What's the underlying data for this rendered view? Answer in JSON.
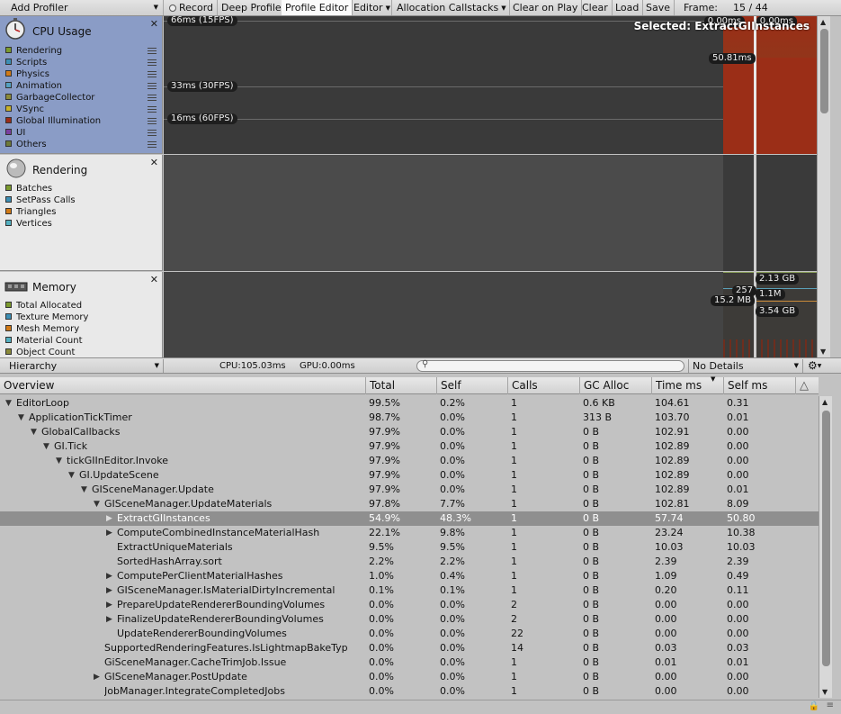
{
  "toolbar": {
    "add_profiler": "Add Profiler",
    "record": "Record",
    "deep_profile": "Deep Profile",
    "profile_editor": "Profile Editor",
    "editor": "Editor",
    "allocation_callstacks": "Allocation Callstacks",
    "clear_on_play": "Clear on Play",
    "clear": "Clear",
    "load": "Load",
    "save": "Save",
    "frame_label": "Frame:",
    "frame_value": "15 / 44"
  },
  "cpu_panel": {
    "title": "CPU Usage",
    "items": [
      {
        "label": "Rendering",
        "color": "#7b9a2e"
      },
      {
        "label": "Scripts",
        "color": "#3d8fb5"
      },
      {
        "label": "Physics",
        "color": "#d17a17"
      },
      {
        "label": "Animation",
        "color": "#54a0c0"
      },
      {
        "label": "GarbageCollector",
        "color": "#8a8a3a"
      },
      {
        "label": "VSync",
        "color": "#c9b22a"
      },
      {
        "label": "Global Illumination",
        "color": "#9b2d1a"
      },
      {
        "label": "UI",
        "color": "#7a3fa0"
      },
      {
        "label": "Others",
        "color": "#6e7a3a"
      }
    ],
    "fps_labels": [
      "66ms (15FPS)",
      "33ms (30FPS)",
      "16ms (60FPS)"
    ],
    "selected_label": "Selected: ExtractGIInstances",
    "top_values": [
      "0.00ms",
      "0.00ms"
    ],
    "selected_value": "50.81ms"
  },
  "rendering_panel": {
    "title": "Rendering",
    "items": [
      {
        "label": "Batches",
        "color": "#7b9a2e"
      },
      {
        "label": "SetPass Calls",
        "color": "#3d8fb5"
      },
      {
        "label": "Triangles",
        "color": "#d17a17"
      },
      {
        "label": "Vertices",
        "color": "#54b0c0"
      }
    ]
  },
  "memory_panel": {
    "title": "Memory",
    "items": [
      {
        "label": "Total Allocated",
        "color": "#7b9a2e"
      },
      {
        "label": "Texture Memory",
        "color": "#3d8fb5"
      },
      {
        "label": "Mesh Memory",
        "color": "#d17a17"
      },
      {
        "label": "Material Count",
        "color": "#54b0c0"
      },
      {
        "label": "Object Count",
        "color": "#8a8a3a"
      }
    ],
    "values": {
      "total": "2.13 GB",
      "count": "257",
      "objects": "1.1M",
      "mesh": "15.2 MB",
      "reserved": "3.54 GB"
    }
  },
  "details_bar": {
    "view_mode": "Hierarchy",
    "cpu": "CPU:105.03ms",
    "gpu": "GPU:0.00ms",
    "search_placeholder": "",
    "details_mode": "No Details"
  },
  "table": {
    "headers": [
      "Overview",
      "Total",
      "Self",
      "Calls",
      "GC Alloc",
      "Time ms",
      "Self ms"
    ],
    "rows": [
      {
        "name": "EditorLoop",
        "depth": 0,
        "expander": "open",
        "total": "99.5%",
        "self": "0.2%",
        "calls": "1",
        "gc": "0.6 KB",
        "time": "104.61",
        "selfms": "0.31"
      },
      {
        "name": "ApplicationTickTimer",
        "depth": 1,
        "expander": "open",
        "total": "98.7%",
        "self": "0.0%",
        "calls": "1",
        "gc": "313 B",
        "time": "103.70",
        "selfms": "0.01"
      },
      {
        "name": "GlobalCallbacks",
        "depth": 2,
        "expander": "open",
        "total": "97.9%",
        "self": "0.0%",
        "calls": "1",
        "gc": "0 B",
        "time": "102.91",
        "selfms": "0.00"
      },
      {
        "name": "GI.Tick",
        "depth": 3,
        "expander": "open",
        "total": "97.9%",
        "self": "0.0%",
        "calls": "1",
        "gc": "0 B",
        "time": "102.89",
        "selfms": "0.00"
      },
      {
        "name": "tickGIInEditor.Invoke",
        "depth": 4,
        "expander": "open",
        "total": "97.9%",
        "self": "0.0%",
        "calls": "1",
        "gc": "0 B",
        "time": "102.89",
        "selfms": "0.00"
      },
      {
        "name": "GI.UpdateScene",
        "depth": 5,
        "expander": "open",
        "total": "97.9%",
        "self": "0.0%",
        "calls": "1",
        "gc": "0 B",
        "time": "102.89",
        "selfms": "0.00"
      },
      {
        "name": "GISceneManager.Update",
        "depth": 6,
        "expander": "open",
        "total": "97.9%",
        "self": "0.0%",
        "calls": "1",
        "gc": "0 B",
        "time": "102.89",
        "selfms": "0.01"
      },
      {
        "name": "GISceneManager.UpdateMaterials",
        "depth": 7,
        "expander": "open",
        "total": "97.8%",
        "self": "7.7%",
        "calls": "1",
        "gc": "0 B",
        "time": "102.81",
        "selfms": "8.09"
      },
      {
        "name": "ExtractGIInstances",
        "depth": 8,
        "expander": "closed",
        "selected": true,
        "total": "54.9%",
        "self": "48.3%",
        "calls": "1",
        "gc": "0 B",
        "time": "57.74",
        "selfms": "50.80"
      },
      {
        "name": "ComputeCombinedInstanceMaterialHash",
        "depth": 8,
        "expander": "closed",
        "total": "22.1%",
        "self": "9.8%",
        "calls": "1",
        "gc": "0 B",
        "time": "23.24",
        "selfms": "10.38"
      },
      {
        "name": "ExtractUniqueMaterials",
        "depth": 8,
        "expander": "none",
        "total": "9.5%",
        "self": "9.5%",
        "calls": "1",
        "gc": "0 B",
        "time": "10.03",
        "selfms": "10.03"
      },
      {
        "name": "SortedHashArray.sort",
        "depth": 8,
        "expander": "none",
        "total": "2.2%",
        "self": "2.2%",
        "calls": "1",
        "gc": "0 B",
        "time": "2.39",
        "selfms": "2.39"
      },
      {
        "name": "ComputePerClientMaterialHashes",
        "depth": 8,
        "expander": "closed",
        "total": "1.0%",
        "self": "0.4%",
        "calls": "1",
        "gc": "0 B",
        "time": "1.09",
        "selfms": "0.49"
      },
      {
        "name": "GISceneManager.IsMaterialDirtyIncremental",
        "depth": 8,
        "expander": "closed",
        "total": "0.1%",
        "self": "0.1%",
        "calls": "1",
        "gc": "0 B",
        "time": "0.20",
        "selfms": "0.11"
      },
      {
        "name": "PrepareUpdateRendererBoundingVolumes",
        "depth": 8,
        "expander": "closed",
        "total": "0.0%",
        "self": "0.0%",
        "calls": "2",
        "gc": "0 B",
        "time": "0.00",
        "selfms": "0.00"
      },
      {
        "name": "FinalizeUpdateRendererBoundingVolumes",
        "depth": 8,
        "expander": "closed",
        "total": "0.0%",
        "self": "0.0%",
        "calls": "2",
        "gc": "0 B",
        "time": "0.00",
        "selfms": "0.00"
      },
      {
        "name": "UpdateRendererBoundingVolumes",
        "depth": 8,
        "expander": "none",
        "total": "0.0%",
        "self": "0.0%",
        "calls": "22",
        "gc": "0 B",
        "time": "0.00",
        "selfms": "0.00"
      },
      {
        "name": "SupportedRenderingFeatures.IsLightmapBakeTyp",
        "depth": 7,
        "expander": "none",
        "total": "0.0%",
        "self": "0.0%",
        "calls": "14",
        "gc": "0 B",
        "time": "0.03",
        "selfms": "0.03"
      },
      {
        "name": "GiSceneManager.CacheTrimJob.Issue",
        "depth": 7,
        "expander": "none",
        "total": "0.0%",
        "self": "0.0%",
        "calls": "1",
        "gc": "0 B",
        "time": "0.01",
        "selfms": "0.01"
      },
      {
        "name": "GISceneManager.PostUpdate",
        "depth": 7,
        "expander": "closed",
        "total": "0.0%",
        "self": "0.0%",
        "calls": "1",
        "gc": "0 B",
        "time": "0.00",
        "selfms": "0.00"
      },
      {
        "name": "JobManager.IntegrateCompletedJobs",
        "depth": 7,
        "expander": "none",
        "total": "0.0%",
        "self": "0.0%",
        "calls": "1",
        "gc": "0 B",
        "time": "0.00",
        "selfms": "0.00"
      }
    ]
  }
}
